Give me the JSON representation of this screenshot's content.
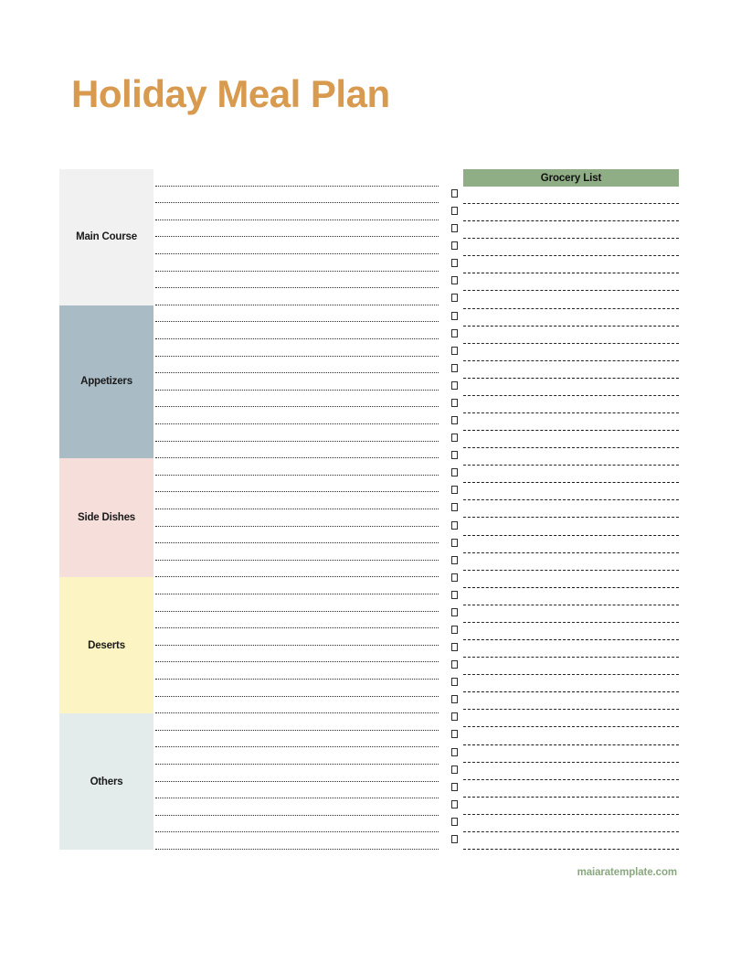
{
  "page": {
    "title": "Holiday Meal Plan",
    "title_color": "#d79a4f",
    "background": "#ffffff"
  },
  "meal_plan": {
    "sections": [
      {
        "label": "Main Course",
        "color": "#f1f1f1",
        "lines": 8
      },
      {
        "label": "Appetizers",
        "color": "#a9bbc5",
        "lines": 9
      },
      {
        "label": "Side Dishes",
        "color": "#f6dedb",
        "lines": 7
      },
      {
        "label": "Deserts",
        "color": "#fcf4c2",
        "lines": 8
      },
      {
        "label": "Others",
        "color": "#e4ebeb",
        "lines": 8
      }
    ]
  },
  "grocery_list": {
    "header": "Grocery List",
    "header_color": "#90ae85",
    "rows": 38,
    "checkbox_icon": "empty-checkbox"
  },
  "footer": {
    "credit": "maiaratemplate.com",
    "credit_color": "#8aa77f"
  }
}
